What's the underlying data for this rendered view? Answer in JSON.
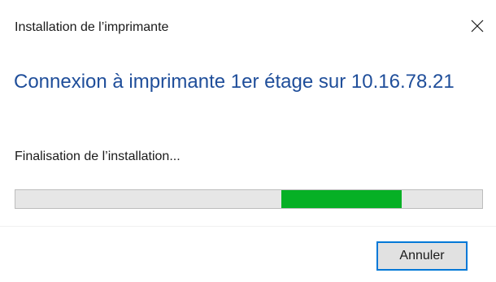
{
  "window": {
    "title": "Installation de l’imprimante",
    "close_icon": "close-icon"
  },
  "main": {
    "heading": "Connexion à imprimante 1er étage sur 10.16.78.21",
    "status": "Finalisation de l’installation...",
    "progress": {
      "mode": "indeterminate",
      "fill_start_fraction": 0.57,
      "fill_end_fraction": 0.827,
      "fill_color": "#06b025"
    }
  },
  "footer": {
    "cancel_label": "Annuler",
    "accent_color": "#0078d7"
  }
}
